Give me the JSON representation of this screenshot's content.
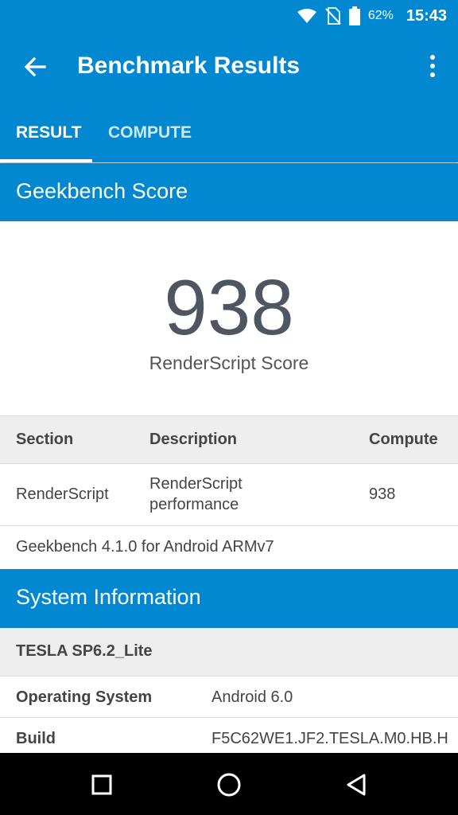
{
  "status_bar": {
    "battery": "62%",
    "time": "15:43"
  },
  "app_bar": {
    "title": "Benchmark Results"
  },
  "tabs": [
    {
      "label": "RESULT"
    },
    {
      "label": "COMPUTE"
    }
  ],
  "score_section": {
    "header": "Geekbench Score",
    "score": "938",
    "score_label": "RenderScript Score"
  },
  "table": {
    "columns": [
      "Section",
      "Description",
      "Compute"
    ],
    "rows": [
      {
        "section": "RenderScript",
        "description_line1": "RenderScript",
        "description_line2": "performance",
        "compute": "938"
      }
    ],
    "footer": "Geekbench 4.1.0 for Android ARMv7"
  },
  "system_info": {
    "header": "System Information",
    "device": "TESLA SP6.2_Lite",
    "rows": [
      {
        "label": "Operating System",
        "value": "Android 6.0"
      },
      {
        "label": "Build",
        "value": "F5C62WE1.JF2.TESLA.M0.HB.H"
      }
    ]
  },
  "colors": {
    "primary": "#0288d1",
    "nav_bar": "#000000"
  }
}
